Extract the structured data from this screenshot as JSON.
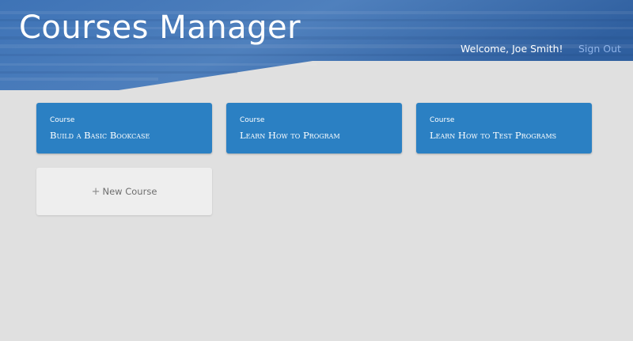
{
  "header": {
    "title": "Courses Manager",
    "welcome": "Welcome, Joe Smith!",
    "sign_out": "Sign Out"
  },
  "courses": [
    {
      "kicker": "Course",
      "title": "Build a Basic Bookcase"
    },
    {
      "kicker": "Course",
      "title": "Learn How to Program"
    },
    {
      "kicker": "Course",
      "title": "Learn How to Test Programs"
    }
  ],
  "new_course": {
    "icon": "plus-icon",
    "label": "New Course"
  },
  "colors": {
    "header_blue": "#3a6fb0",
    "card_blue": "#2b80c3",
    "background": "#e0e0e0",
    "sign_out_link": "#8fb3e8"
  }
}
